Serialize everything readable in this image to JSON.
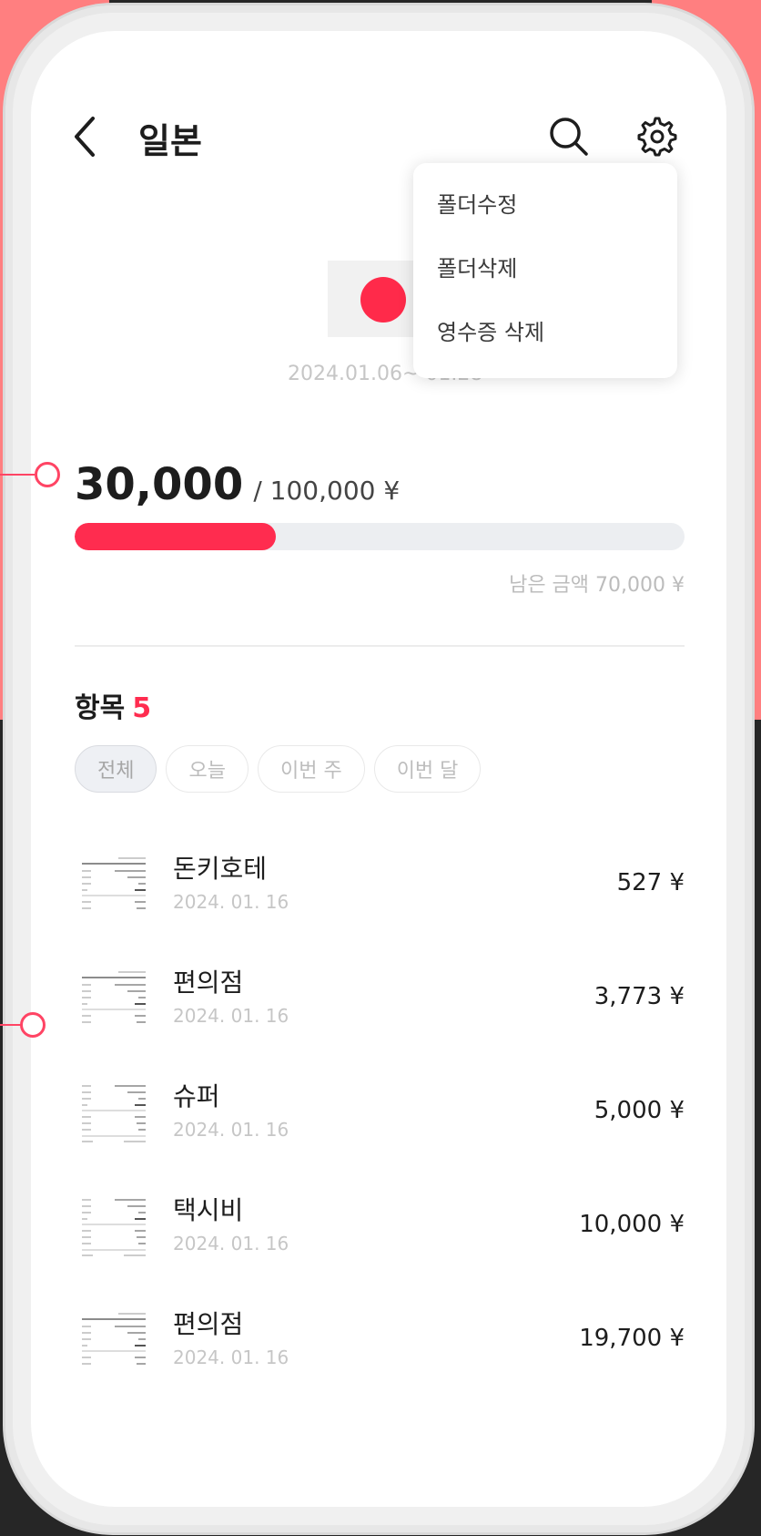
{
  "header": {
    "title": "일본",
    "back_icon": "chevron-left-icon",
    "search_icon": "search-icon",
    "settings_icon": "gear-icon"
  },
  "menu": {
    "items": [
      "폴더수정",
      "폴더삭제",
      "영수증 삭제"
    ]
  },
  "folder": {
    "flag_color": "#ff2a4a",
    "date_range": "2024.01.06~ 01.28"
  },
  "budget": {
    "spent": "30,000",
    "total": "/ 100,000 ¥",
    "progress_fraction": 0.33,
    "remaining": "남은 금액 70,000 ¥"
  },
  "items_section": {
    "title": "항목",
    "count": "5",
    "filters": [
      "전체",
      "오늘",
      "이번 주",
      "이번 달"
    ],
    "active_filter": "전체"
  },
  "receipts": [
    {
      "merchant": "돈키호테",
      "date": "2024. 01. 16",
      "amount": "527 ¥"
    },
    {
      "merchant": "편의점",
      "date": "2024. 01. 16",
      "amount": "3,773 ¥"
    },
    {
      "merchant": "슈퍼",
      "date": "2024. 01. 16",
      "amount": "5,000 ¥"
    },
    {
      "merchant": "택시비",
      "date": "2024. 01. 16",
      "amount": "10,000 ¥"
    },
    {
      "merchant": "편의점",
      "date": "2024. 01. 16",
      "amount": "19,700 ¥"
    }
  ],
  "colors": {
    "accent": "#ff2c4f",
    "background_pink": "#ff7f80",
    "background_dark": "#262626"
  }
}
